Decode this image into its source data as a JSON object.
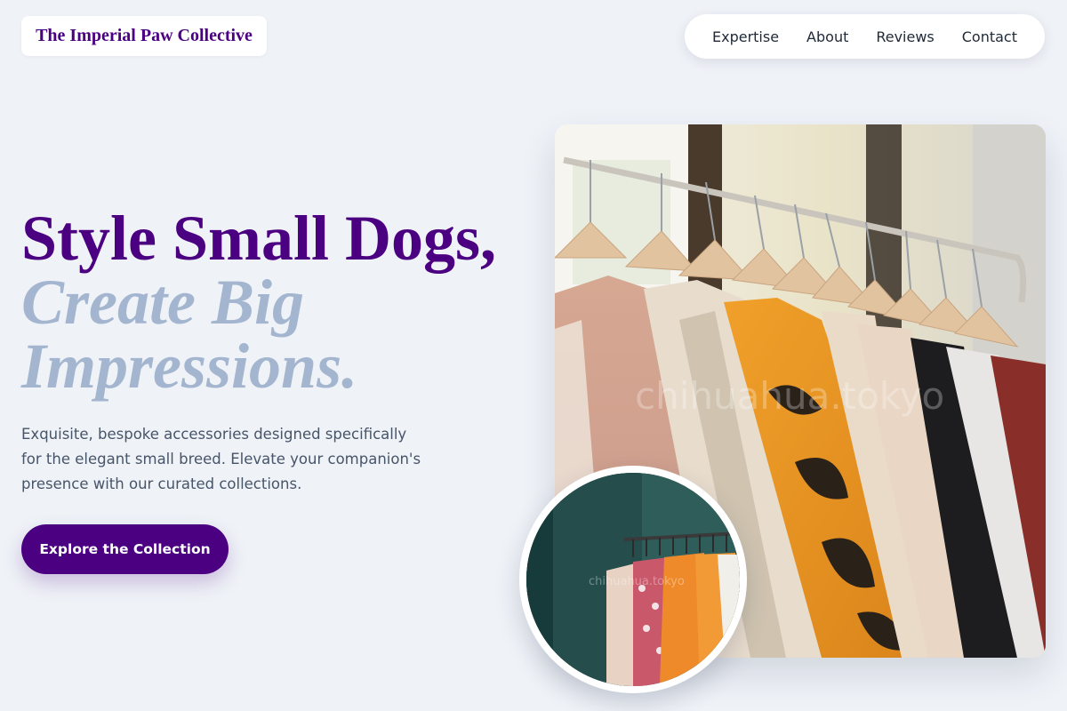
{
  "brand": {
    "name": "The Imperial Paw Collective"
  },
  "nav": {
    "items": [
      {
        "label": "Expertise"
      },
      {
        "label": "About"
      },
      {
        "label": "Reviews"
      },
      {
        "label": "Contact"
      }
    ]
  },
  "hero": {
    "headline_primary": "Style Small Dogs,",
    "headline_secondary": "Create Big Impressions.",
    "subtitle": "Exquisite, bespoke accessories designed specifically for the elegant small breed. Elevate your companion's presence with our curated collections.",
    "cta_label": "Explore the Collection",
    "image_watermark": "chihuahua.tokyo",
    "thumb_watermark": "chihuahua.tokyo"
  },
  "colors": {
    "accent": "#4b0082",
    "muted_headline": "#a3b5cf",
    "background": "#eff2f7"
  }
}
